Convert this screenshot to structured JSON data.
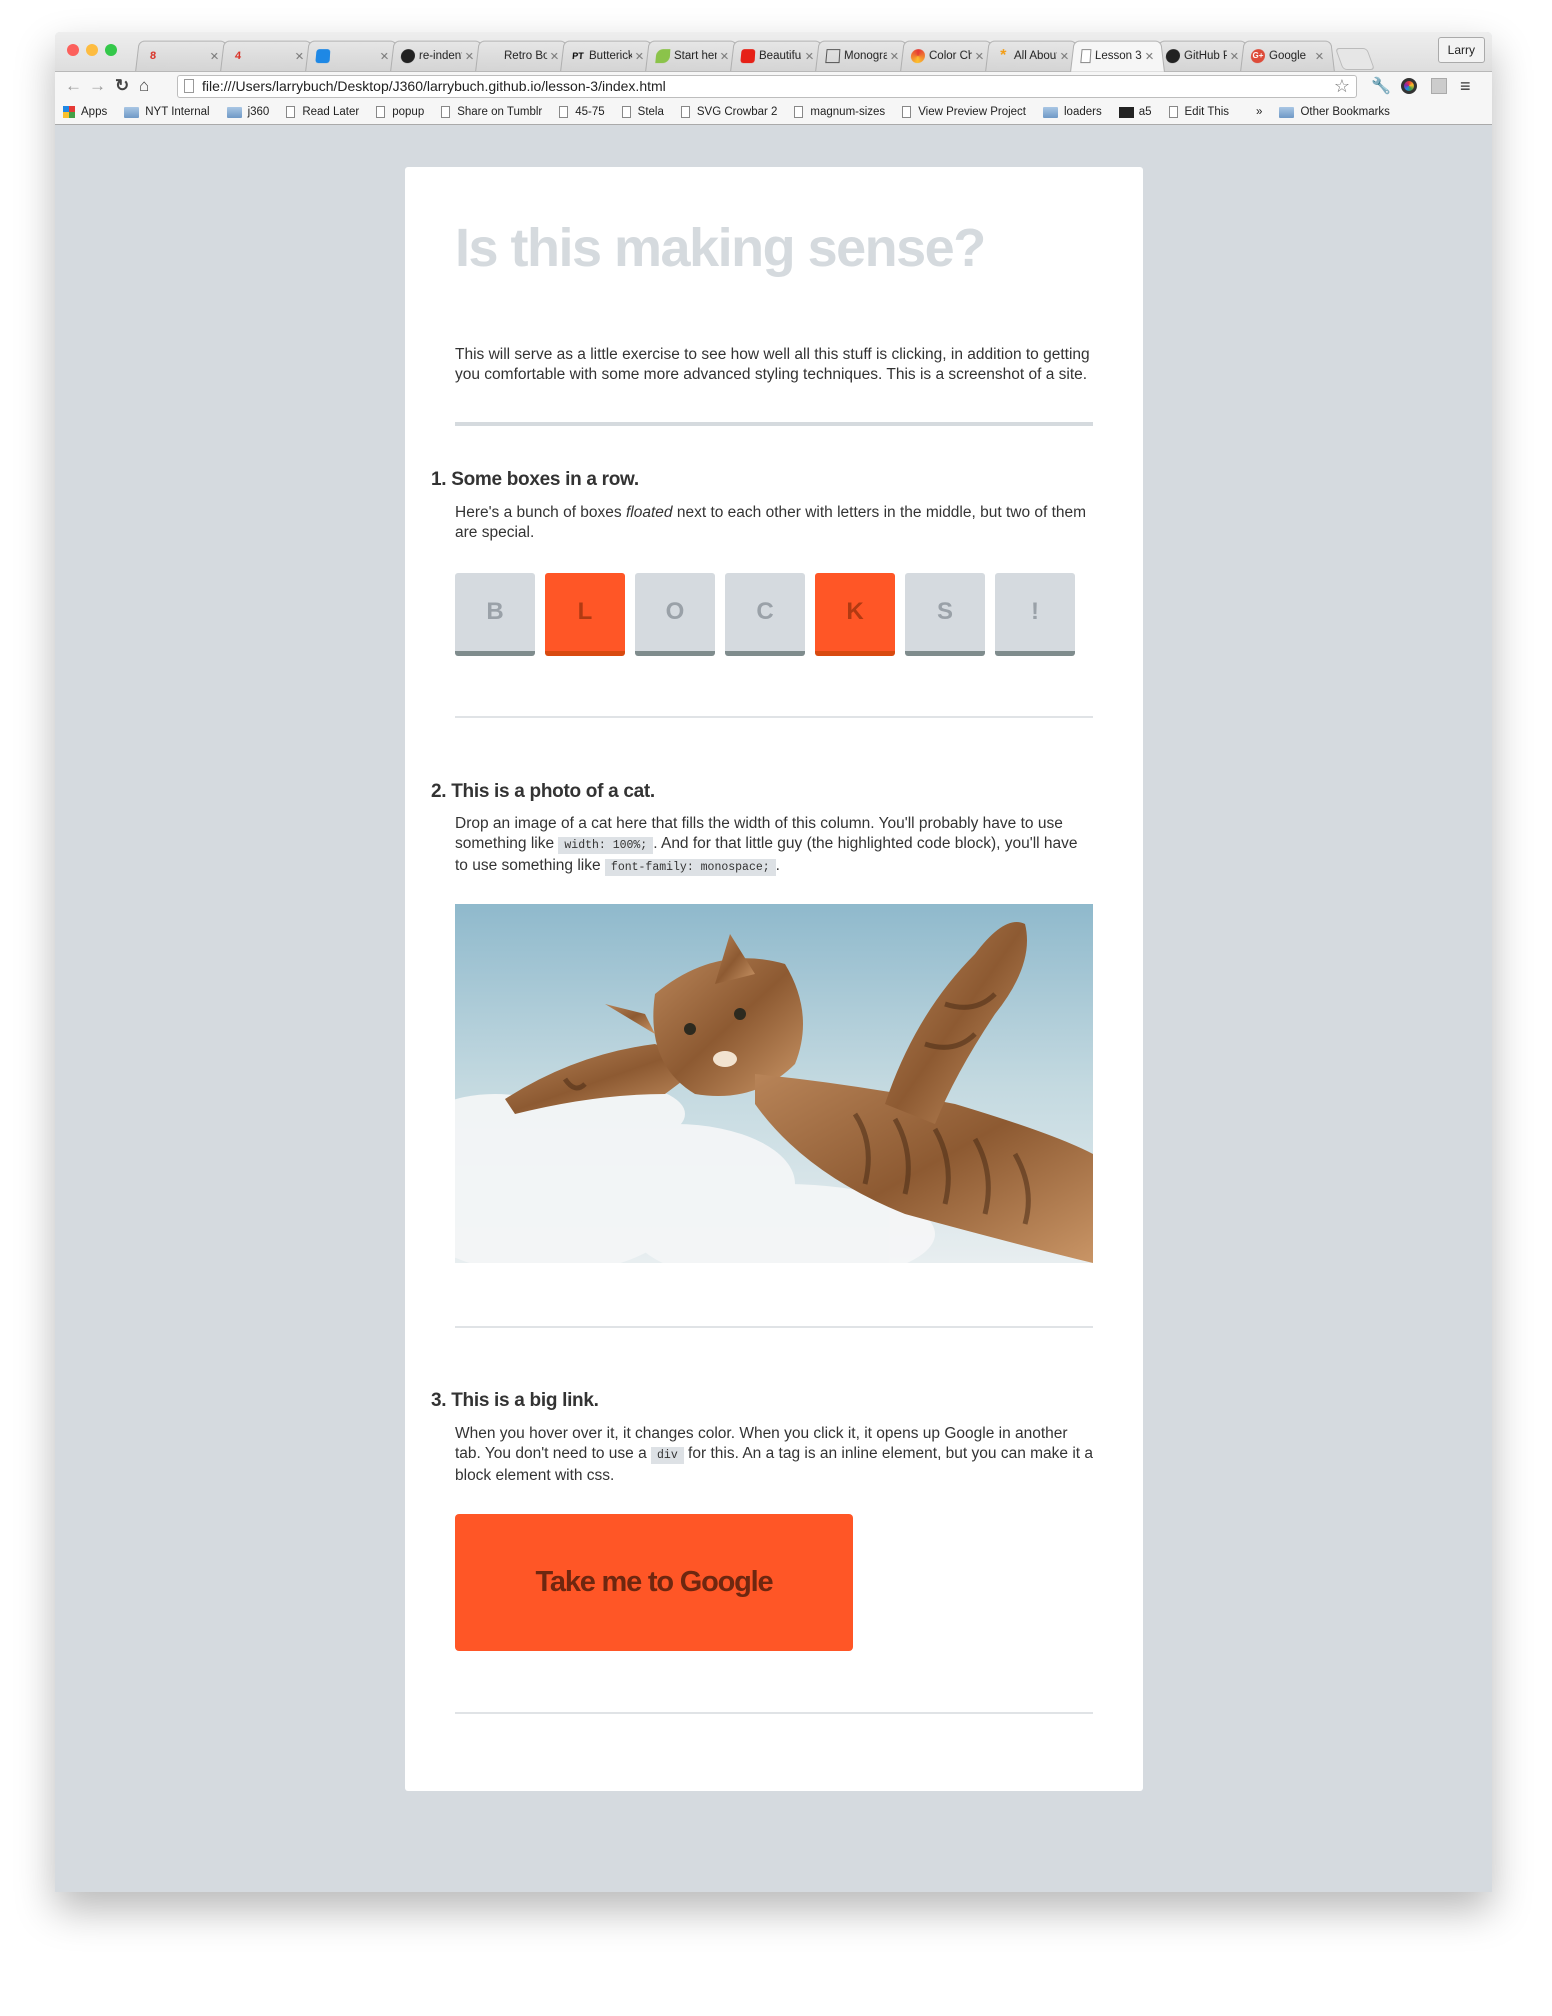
{
  "browser": {
    "tabs": [
      {
        "icon": "gmail-icon",
        "label": "8",
        "title": ""
      },
      {
        "icon": "gmail-icon",
        "label": "4",
        "title": ""
      },
      {
        "icon": "app-icon",
        "label": "",
        "title": ""
      },
      {
        "icon": "github-icon",
        "label": "",
        "title": "re-indent i"
      },
      {
        "icon": "rook-icon",
        "label": "",
        "title": "Retro Bool"
      },
      {
        "icon": "pt-icon",
        "label": "PT",
        "title": "Butterick's"
      },
      {
        "icon": "leaf-icon",
        "label": "",
        "title": "Start here!"
      },
      {
        "icon": "youtube-icon",
        "label": "",
        "title": "Beautiful D"
      },
      {
        "icon": "monitor-icon",
        "label": "",
        "title": "Monograp"
      },
      {
        "icon": "color-wheel-icon",
        "label": "",
        "title": "Color Cha"
      },
      {
        "icon": "asterisk-icon",
        "label": "*",
        "title": "All About F"
      },
      {
        "icon": "page-icon",
        "label": "",
        "title": "Lesson 3",
        "active": true
      },
      {
        "icon": "github-icon",
        "label": "",
        "title": "GitHub Pa"
      },
      {
        "icon": "google-plus-icon",
        "label": "G+",
        "title": "Google"
      }
    ],
    "profile": "Larry",
    "url": "file:///Users/larrybuch/Desktop/J360/larrybuch.github.io/lesson-3/index.html",
    "bookmarks": [
      {
        "icon": "apps-icon",
        "label": "Apps"
      },
      {
        "icon": "folder-icon",
        "label": "NYT Internal"
      },
      {
        "icon": "folder-icon",
        "label": "j360"
      },
      {
        "icon": "page-icon",
        "label": "Read Later"
      },
      {
        "icon": "page-icon",
        "label": "popup"
      },
      {
        "icon": "page-icon",
        "label": "Share on Tumblr"
      },
      {
        "icon": "page-icon",
        "label": "45-75"
      },
      {
        "icon": "page-icon",
        "label": "Stela"
      },
      {
        "icon": "page-icon",
        "label": "SVG Crowbar 2"
      },
      {
        "icon": "page-icon",
        "label": "magnum-sizes"
      },
      {
        "icon": "page-icon",
        "label": "View Preview Project"
      },
      {
        "icon": "folder-icon",
        "label": "loaders"
      },
      {
        "icon": "a5-icon",
        "label": "a5"
      },
      {
        "icon": "page-icon",
        "label": "Edit This"
      }
    ],
    "overflow": "»",
    "other_bookmarks": "Other Bookmarks"
  },
  "page": {
    "title": "Is this making sense?",
    "intro": "This will serve as a little exercise to see how well all this stuff is clicking, in addition to getting you comfortable with some more advanced styling techniques. This is a screenshot of a site.",
    "section1": {
      "heading": "1. Some boxes in a row.",
      "text_a": "Here's a bunch of boxes ",
      "text_em": "floated",
      "text_b": " next to each other with letters in the middle, but two of them are special.",
      "boxes": [
        {
          "letter": "B",
          "special": false
        },
        {
          "letter": "L",
          "special": true
        },
        {
          "letter": "O",
          "special": false
        },
        {
          "letter": "C",
          "special": false
        },
        {
          "letter": "K",
          "special": true
        },
        {
          "letter": "S",
          "special": false
        },
        {
          "letter": "!",
          "special": false
        }
      ]
    },
    "section2": {
      "heading": "2. This is a photo of a cat.",
      "text_a": "Drop an image of a cat here that fills the width of this column. You'll probably have to use something like ",
      "code1": "width: 100%;",
      "text_b": ". And for that little guy (the highlighted code block), you'll have to use something like ",
      "code2": "font-family: monospace;",
      "text_c": "."
    },
    "section3": {
      "heading": "3. This is a big link.",
      "text_a": "When you hover over it, it changes color. When you click it, it opens up Google in another tab. You don't need to use a ",
      "code": "div",
      "text_b": " for this. An a tag is an inline element, but you can make it a block element with css.",
      "button": "Take me to Google"
    }
  },
  "colors": {
    "accent": "#ff5626",
    "box_gray": "#d5dadf",
    "title_gray": "#d5dade",
    "page_bg": "#d5dadf"
  }
}
